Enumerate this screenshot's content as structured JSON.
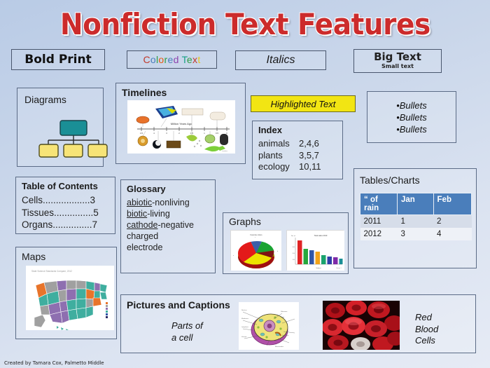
{
  "poster": {
    "title": "Nonfiction Text Features",
    "title_color": "#cc2b2b",
    "background_color": "#c9d6ea",
    "credit": "Created by Tamara Cox, Palmetto Middle"
  },
  "top_features": {
    "bold_print": "Bold Print",
    "colored_text": {
      "label": "Colored Text",
      "letters": [
        {
          "ch": "C",
          "color": "#c0392b"
        },
        {
          "ch": "o",
          "color": "#4a7ebb"
        },
        {
          "ch": "l",
          "color": "#2f9e44"
        },
        {
          "ch": "o",
          "color": "#e8590c"
        },
        {
          "ch": "r",
          "color": "#2f9e44"
        },
        {
          "ch": "e",
          "color": "#4a7ebb"
        },
        {
          "ch": "d",
          "color": "#8e44ad"
        },
        {
          "ch": " ",
          "color": "#000000"
        },
        {
          "ch": "T",
          "color": "#16a085"
        },
        {
          "ch": "e",
          "color": "#2f9e44"
        },
        {
          "ch": "x",
          "color": "#c0392b"
        },
        {
          "ch": "t",
          "color": "#e8c81e"
        }
      ]
    },
    "italics": "Italics",
    "big_text": "Big Text",
    "small_text": "Small text"
  },
  "diagrams": {
    "heading": "Diagrams",
    "parent_color": "#1a8f96",
    "child_color": "#f7e477",
    "children": 3
  },
  "timelines": {
    "heading": "Timelines",
    "image_alt": "geologic-timeline-illustration"
  },
  "highlighted": {
    "label": "Highlighted Text",
    "highlight_color": "#f2e513"
  },
  "bullets": {
    "items": [
      "•Bullets",
      "•Bullets",
      "•Bullets"
    ]
  },
  "index": {
    "heading": "Index",
    "entries": [
      {
        "term": "animals",
        "pages": "2,4,6"
      },
      {
        "term": "plants",
        "pages": "3,5,7"
      },
      {
        "term": "ecology",
        "pages": "10,11"
      }
    ]
  },
  "table_of_contents": {
    "heading": "Table of Contents",
    "entries": [
      "Cells..................3",
      "Tissues...............5",
      "Organs...............7"
    ]
  },
  "glossary": {
    "heading": "Glossary",
    "entries": [
      {
        "term": "abiotic",
        "definition": "-nonliving"
      },
      {
        "term": "biotic",
        "definition": "-living"
      },
      {
        "term": "cathode",
        "definition": "-negative"
      },
      {
        "term": "",
        "definition": "charged"
      },
      {
        "term": "",
        "definition": "electrode"
      }
    ]
  },
  "graphs": {
    "heading": "Graphs",
    "pie_alt": "pie-chart-illustration",
    "bar_alt": "bar-chart-illustration"
  },
  "tables_charts": {
    "heading": "Tables/Charts",
    "columns": [
      "“ of rain",
      "Jan",
      "Feb"
    ],
    "rows": [
      [
        "2011",
        "1",
        "2"
      ],
      [
        "2012",
        "3",
        "4"
      ]
    ],
    "header_color": "#4a7ebb"
  },
  "maps": {
    "heading": "Maps",
    "image_caption": "State Science Standards Compare, 2012"
  },
  "pictures_captions": {
    "heading": "Pictures and Captions",
    "caption_left": "Parts of\na cell",
    "caption_left_line1": "Parts of",
    "caption_left_line2": "a cell",
    "caption_right_line1": "Red",
    "caption_right_line2": "Blood",
    "caption_right_line3": "Cells",
    "image_left_alt": "animal-cell-diagram",
    "image_right_alt": "red-blood-cells-photo"
  },
  "chart_data": [
    {
      "type": "pie",
      "title": "",
      "categories": [
        "slice-blue",
        "slice-green",
        "slice-darkred",
        "slice-yellow",
        "slice-red"
      ],
      "values": [
        14,
        18,
        10,
        26,
        32
      ],
      "colors": [
        "#3b5fa8",
        "#1aa332",
        "#7d1313",
        "#ece400",
        "#e31a1a"
      ]
    },
    {
      "type": "bar",
      "title": "Total sales 2010",
      "xlabel": "Subject",
      "ylabel": "No. of",
      "categories": [
        "A",
        "B",
        "C",
        "D",
        "E",
        "F",
        "G",
        "H"
      ],
      "values": [
        88,
        58,
        52,
        48,
        34,
        30,
        26,
        20
      ],
      "colors": [
        "#e02424",
        "#27a83c",
        "#3056a8",
        "#f2a31a",
        "#1aa36e",
        "#2f3fa8",
        "#7d2aa8",
        "#1a8f96"
      ],
      "ylim": [
        0,
        100
      ],
      "grid": false,
      "legend": "none"
    },
    {
      "type": "table",
      "title": "Tables/Charts",
      "columns": [
        "“ of rain",
        "Jan",
        "Feb"
      ],
      "rows": [
        [
          "2011",
          1,
          2
        ],
        [
          "2012",
          3,
          4
        ]
      ]
    }
  ]
}
